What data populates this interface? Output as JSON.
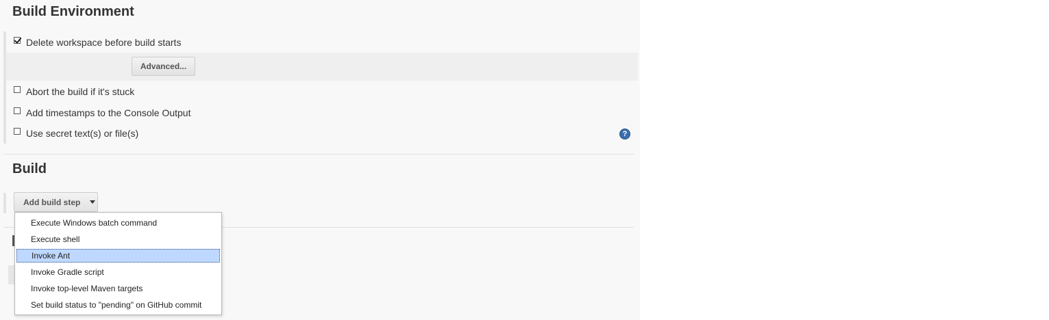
{
  "build_environment": {
    "title": "Build Environment",
    "options": [
      {
        "label": "Delete workspace before build starts",
        "checked": true
      },
      {
        "label": "Abort the build if it's stuck",
        "checked": false
      },
      {
        "label": "Add timestamps to the Console Output",
        "checked": false
      },
      {
        "label": "Use secret text(s) or file(s)",
        "checked": false
      }
    ],
    "advanced_label": "Advanced...",
    "help_glyph": "?"
  },
  "build": {
    "title": "Build",
    "add_step_label": "Add build step",
    "menu": {
      "items": [
        "Execute Windows batch command",
        "Execute shell",
        "Invoke Ant",
        "Invoke Gradle script",
        "Invoke top-level Maven targets",
        "Set build status to \"pending\" on GitHub commit"
      ],
      "selected": "Invoke Ant"
    }
  },
  "icons": {
    "checkbox": "checkbox-icon",
    "help": "help-icon",
    "caret": "chevron-down-icon"
  },
  "colors": {
    "panel_bg": "#f8f8f8",
    "selection_bg": "#bfd8ff",
    "help_blue": "#3a6fb0"
  }
}
